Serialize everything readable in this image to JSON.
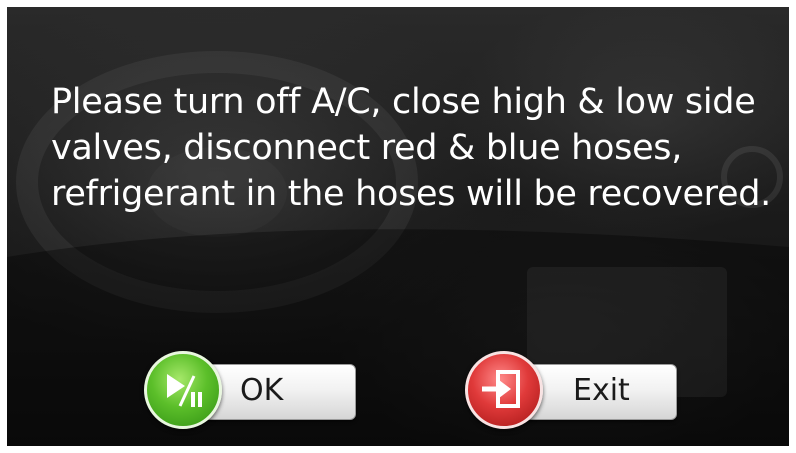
{
  "message": {
    "text": "Please turn off A/C, close high & low side valves, disconnect red & blue hoses, refrigerant in the hoses will be recovered."
  },
  "buttons": {
    "ok": {
      "label": "OK",
      "icon": "play-pause-icon",
      "color": "#5cbf2a"
    },
    "exit": {
      "label": "Exit",
      "icon": "exit-door-icon",
      "color": "#e03a3a"
    }
  }
}
